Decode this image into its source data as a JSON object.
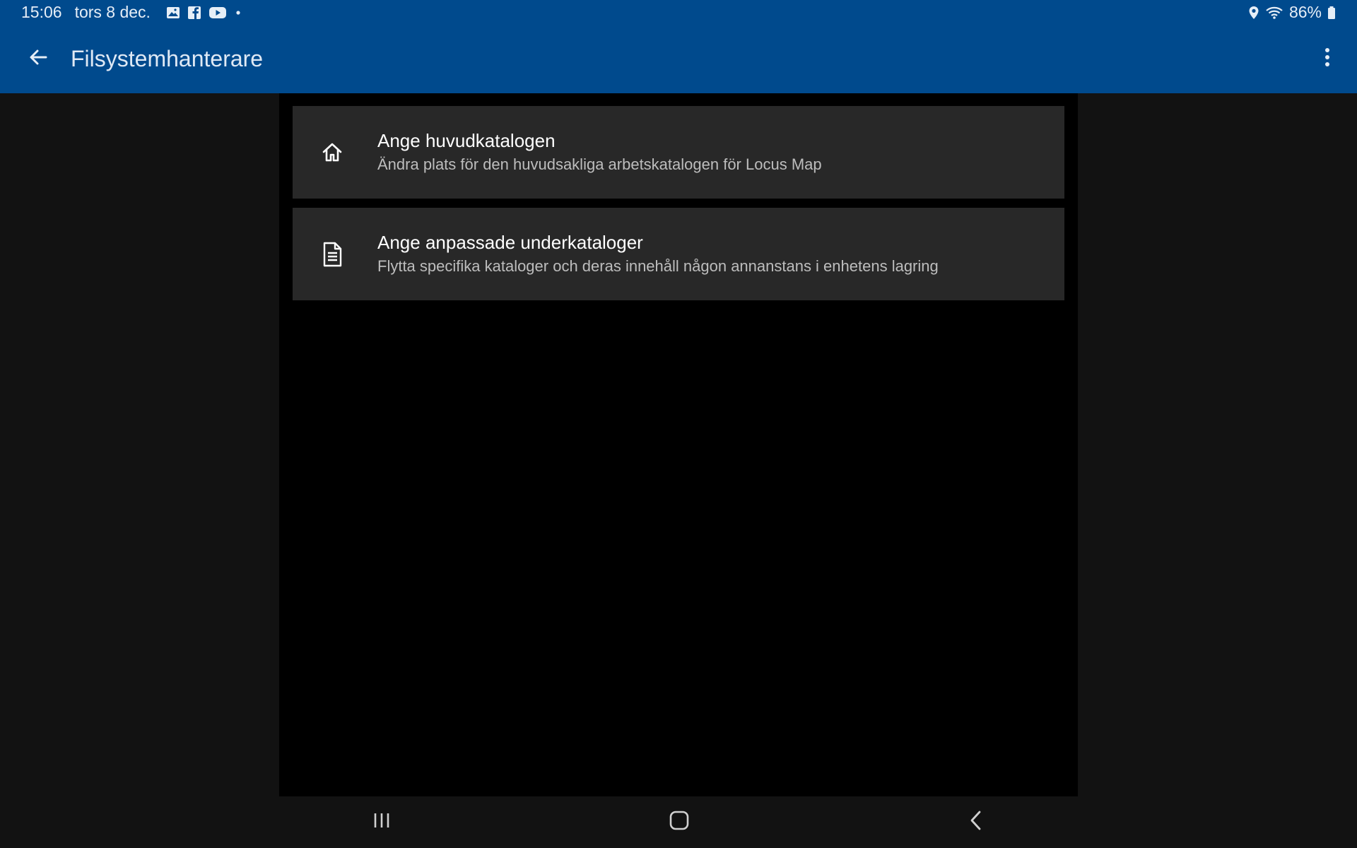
{
  "status_bar": {
    "time": "15:06",
    "date": "tors 8 dec.",
    "notification_icons": [
      "gallery-icon",
      "facebook-icon",
      "youtube-icon",
      "dot-icon"
    ],
    "battery": "86%",
    "system_icons": [
      "location-icon",
      "wifi-icon",
      "battery-icon"
    ]
  },
  "app_bar": {
    "title": "Filsystemhanterare",
    "back_icon": "arrow-left-icon",
    "menu_icon": "more-vert-icon"
  },
  "items": [
    {
      "icon": "home-icon",
      "title": "Ange huvudkatalogen",
      "subtitle": "Ändra plats för den huvudsakliga arbetskatalogen för Locus Map"
    },
    {
      "icon": "document-icon",
      "title": "Ange anpassade underkataloger",
      "subtitle": "Flytta specifika kataloger och deras innehåll någon annanstans i enhetens lagring"
    }
  ],
  "nav_bar": {
    "buttons": [
      "recent-apps-icon",
      "home-button-icon",
      "back-chevron-icon"
    ]
  },
  "colors": {
    "primary": "#004a8d",
    "background": "#121212",
    "content": "#000000",
    "card": "#282828"
  }
}
